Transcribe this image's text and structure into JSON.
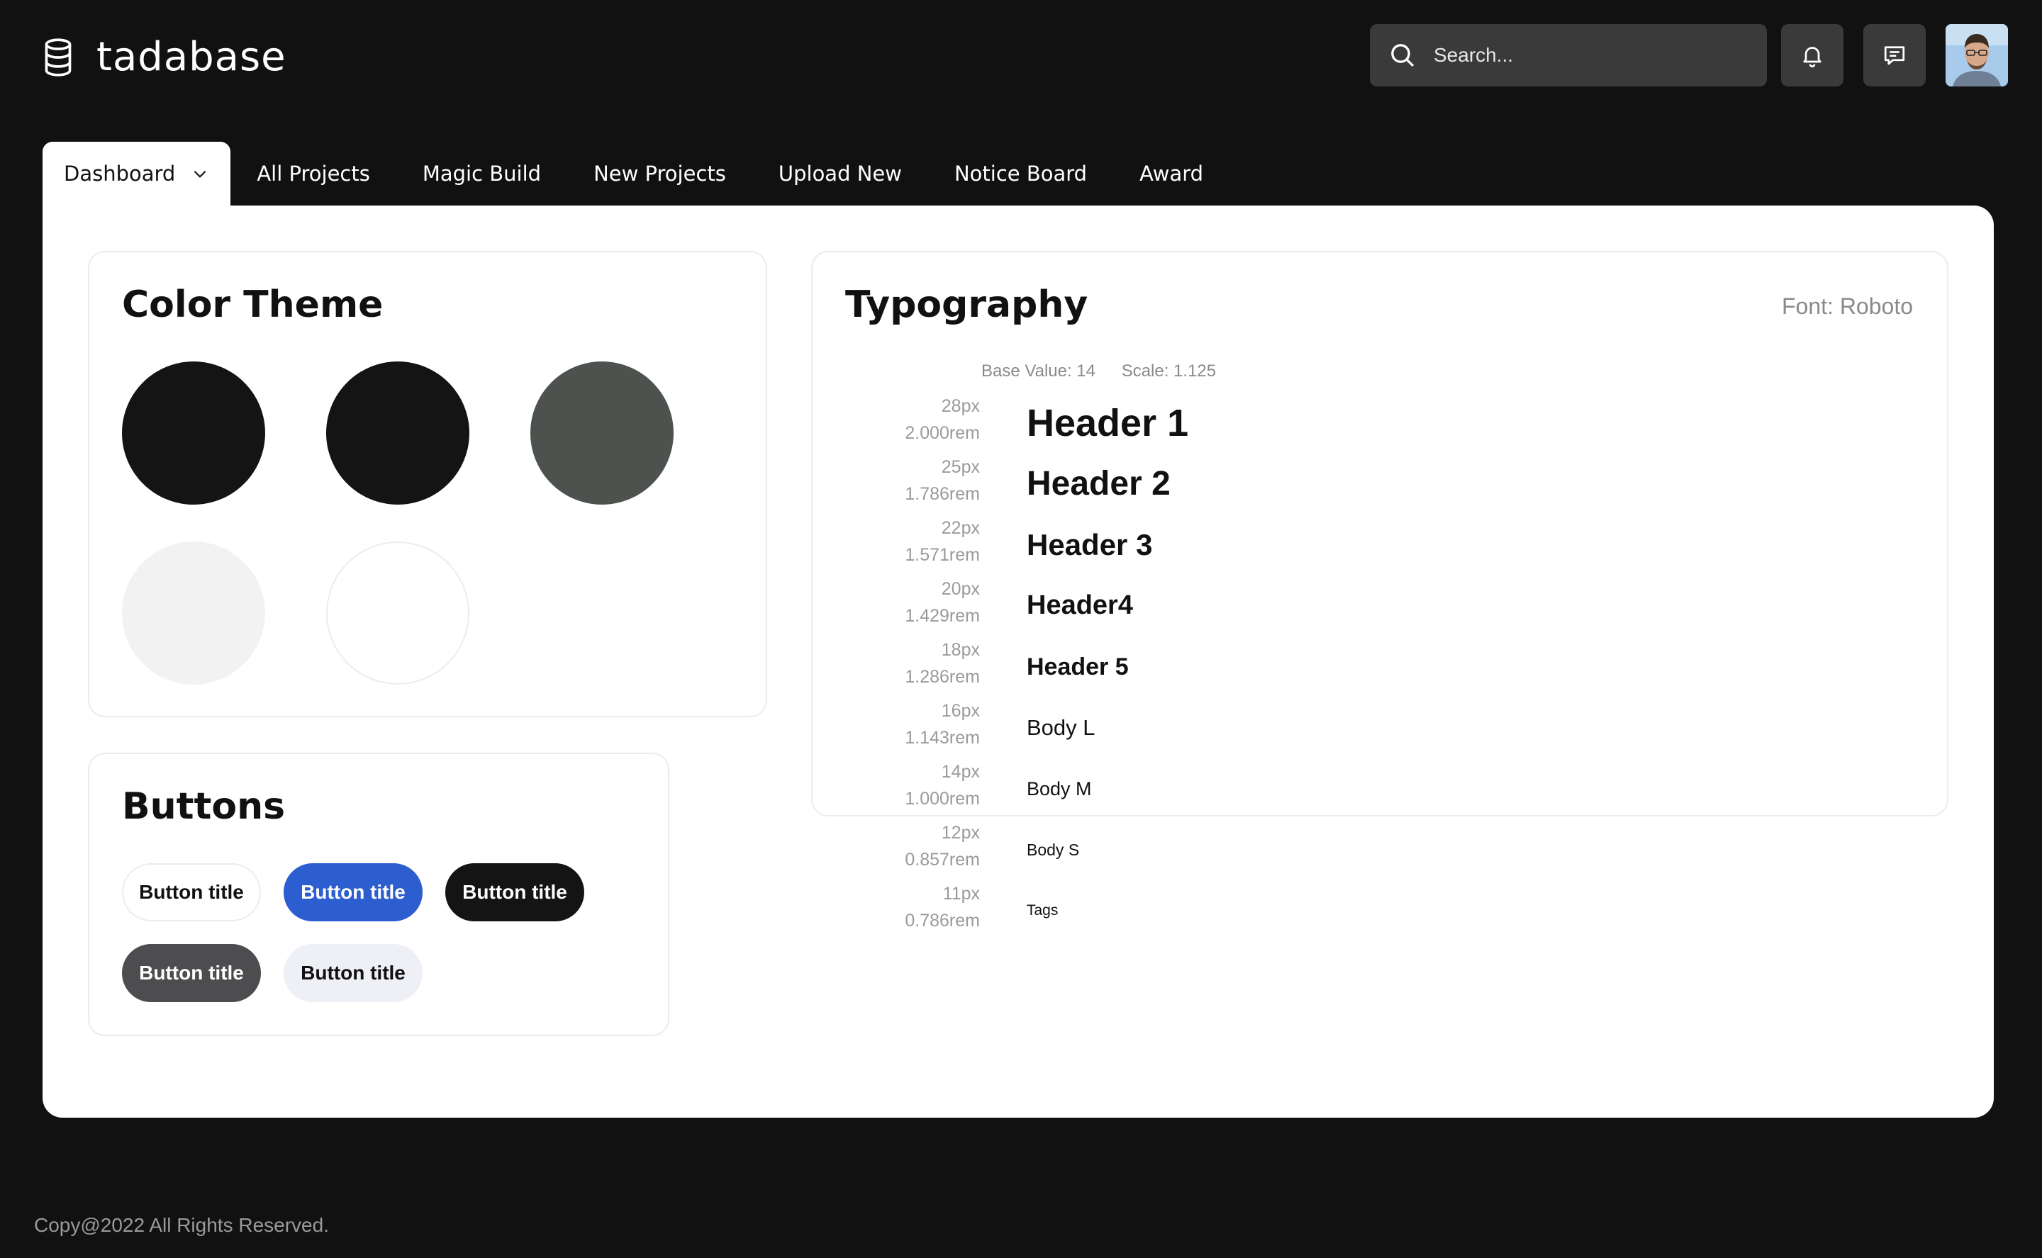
{
  "header": {
    "brand": "tadabase",
    "search_placeholder": "Search...",
    "icons": [
      "database-icon",
      "search-icon",
      "bell-icon",
      "message-icon"
    ]
  },
  "tabs": [
    {
      "label": "Dashboard",
      "active": true
    },
    {
      "label": "All Projects"
    },
    {
      "label": "Magic Build"
    },
    {
      "label": "New Projects"
    },
    {
      "label": "Upload New"
    },
    {
      "label": "Notice Board"
    },
    {
      "label": "Award"
    }
  ],
  "color_theme": {
    "title": "Color Theme",
    "swatches": [
      "#141414",
      "#141414",
      "#4e524e",
      "#f1f2f1",
      "#ffffff"
    ]
  },
  "buttons": {
    "title": "Buttons",
    "items": [
      {
        "label": "Button title",
        "bg": "#ffffff",
        "fg": "#111111",
        "border": "#ececec"
      },
      {
        "label": "Button title",
        "bg": "#2d5ecf",
        "fg": "#ffffff",
        "border": "#2d5ecf"
      },
      {
        "label": "Button title",
        "bg": "#141414",
        "fg": "#ffffff",
        "border": "#141414"
      },
      {
        "label": "Button title",
        "bg": "#4d4d50",
        "fg": "#ffffff",
        "border": "#4d4d50"
      },
      {
        "label": "Button title",
        "bg": "#eef0f6",
        "fg": "#111111",
        "border": "#eef0f6"
      }
    ]
  },
  "typography": {
    "title": "Typography",
    "font_note": "Font: Roboto",
    "base_value": "Base Value: 14",
    "scale": "Scale: 1.125",
    "styles": [
      {
        "px": "28px",
        "rem": "2.000rem",
        "label": "Header 1",
        "bold": true
      },
      {
        "px": "25px",
        "rem": "1.786rem",
        "label": "Header 2",
        "bold": true
      },
      {
        "px": "22px",
        "rem": "1.571rem",
        "label": "Header 3",
        "bold": true
      },
      {
        "px": "20px",
        "rem": "1.429rem",
        "label": "Header4",
        "bold": true
      },
      {
        "px": "18px",
        "rem": "1.286rem",
        "label": "Header 5",
        "bold": true
      },
      {
        "px": "16px",
        "rem": "1.143rem",
        "label": "Body L",
        "bold": false
      },
      {
        "px": "14px",
        "rem": "1.000rem",
        "label": "Body M",
        "bold": false
      },
      {
        "px": "12px",
        "rem": "0.857rem",
        "label": "Body S",
        "bold": false
      },
      {
        "px": "11px",
        "rem": "0.786rem",
        "label": "Tags",
        "bold": false
      }
    ]
  },
  "footer": {
    "text": "Copy@2022 All Rights Reserved."
  }
}
